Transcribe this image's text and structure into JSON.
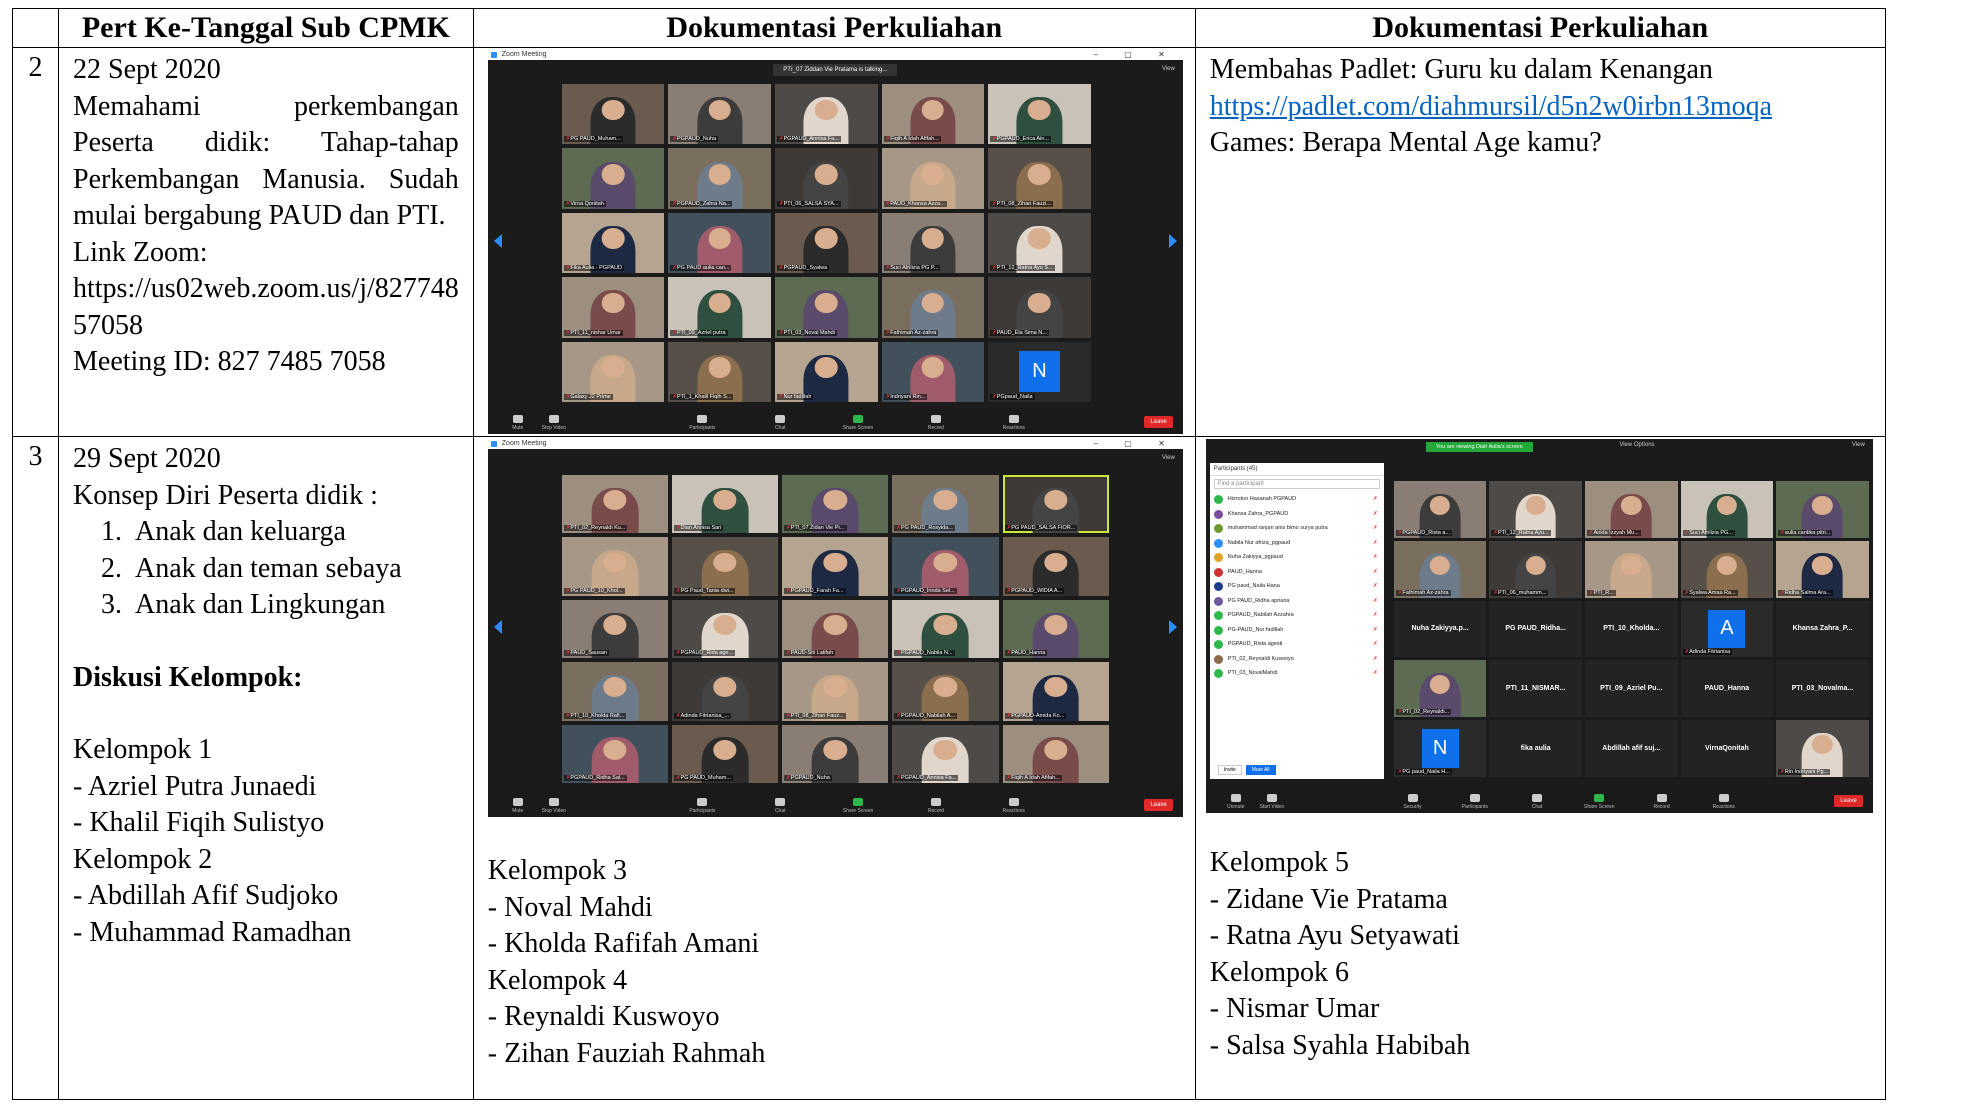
{
  "headers": [
    "Pert Ke-Tanggal Sub CPMK",
    "Dokumentasi Perkuliahan",
    "Dokumentasi Perkuliahan"
  ],
  "row2": {
    "num": "2",
    "date": "22 Sept 2020",
    "desc": "Memahami perkembangan Peserta didik: Tahap-tahap Perkembangan Manusia. Sudah mulai bergabung PAUD dan PTI.",
    "link_label": "Link Zoom:",
    "link_line1": "https://us02web.zoom.us/j/827748",
    "link_line2": "57058",
    "meeting": "Meeting ID: 827 7485 7058",
    "col3_line1": "Membahas Padlet: Guru ku dalam Kenangan",
    "col3_link": "https://padlet.com/diahmursil/d5n2w0irbn13moqa",
    "col3_line3": "Games: Berapa Mental Age kamu?",
    "zoom": {
      "title": "Zoom Meeting",
      "talking": "PTI_07 Ziddan Vie Pratama is talking...",
      "view": "View",
      "tiles": [
        "PG PAUD_Muham...",
        "PGPAUD_Nuha",
        "PGPAUD_Annisa Fa...",
        "Fiqih A Idah Afifah...",
        "PGPAUD_Erica Ain...",
        "Virna Qonitah",
        "PGPAUD_Zahra Na...",
        "PTI_06_SALSA SYA...",
        "PAUD_Khansa Azza...",
        "PTI_08_Zihan Fauzi...",
        "Fika Aulia - PGPAUD",
        "PG PAUD aulia can...",
        "PGPAUD_Syalwa",
        "Suci Afrilizia PG P...",
        "PTI_12_Ratna Ayu S...",
        "PTI_11_nishar Umar",
        "PTI_09_Azriel putra",
        "PTI_03_Noval Mahdi",
        "Fathimah Az-zahra",
        "PAUD_Ela Sima N...",
        "Galaxy J2 Prime",
        "PTI_1_Khalil Fiqih S...",
        "Nur fadillah",
        "Indriyani Rin...",
        "PGpaud_Naila"
      ],
      "letter": "N",
      "toolbar": [
        "Mute",
        "Stop Video",
        "Participants",
        "Chat",
        "Share Screen",
        "Record",
        "Reactions"
      ],
      "leave": "Leave"
    }
  },
  "row3": {
    "num": "3",
    "date": "29 Sept 2020",
    "title": "Konsep Diri Peserta didik :",
    "items": [
      "Anak dan keluarga",
      "Anak dan teman sebaya",
      "Anak dan Lingkungan"
    ],
    "diskusi": "Diskusi Kelompok:",
    "k1": "Kelompok 1",
    "k1a": "- Azriel Putra Junaedi",
    "k1b": "- Khalil Fiqih Sulistyo",
    "k2": "Kelompok 2",
    "k2a": "- Abdillah Afif Sudjoko",
    "k2b": "- Muhammad Ramadhan",
    "k3": "Kelompok 3",
    "k3a": "- Noval Mahdi",
    "k3b": "- Kholda Rafifah Amani",
    "k4": "Kelompok 4",
    "k4a": "- Reynaldi Kuswoyo",
    "k4b": "- Zihan Fauziah Rahmah",
    "k5": "Kelompok 5",
    "k5a": "- Zidane Vie Pratama",
    "k5b": "- Ratna Ayu Setyawati",
    "k6": "Kelompok 6",
    "k6a": "- Nismar Umar",
    "k6b": "- Salsa Syahla Habibah",
    "zoomA": {
      "title": "Zoom Meeting",
      "view": "View",
      "tiles": [
        "PTI_02_Reynaldi Ku...",
        "Dian Annisa Sari",
        "PTI_07 Zidan Vie Pr...",
        "PG PAUD_Rosyida...",
        "PG PAUD_SALSA FIOR...",
        "PG PAUD_10_Khol...",
        "PG Paud_Tania dwi...",
        "PGPAUD_Farah Fa...",
        "PGPAUD_Irinda Sel...",
        "PGPAUD_WIDIA A...",
        "PAUD_Sausan",
        "PGPAUD_Rida age...",
        "PAUD-Siti Latifah",
        "PGPAUD_Nabila N...",
        "PAUD_Hanna",
        "PTI_10_Kholda Rafi...",
        "Adinda Fitrianisa_...",
        "PTI_08_Zihan Fauz...",
        "PGPAUD_Nabilah A...",
        "PGPAUD-Amida Ko...",
        "PGPAUD_Ridha Sal...",
        "PG PAUD_Muham...",
        "PGPAUD_Nuha",
        "PGPAUD_Annisa Fa...",
        "Fiqih A Idah Afifah..."
      ],
      "toolbar": [
        "Mute",
        "Stop Video",
        "Participants",
        "Chat",
        "Share Screen",
        "Record",
        "Reactions"
      ],
      "leave": "Leave"
    },
    "zoomB": {
      "banner": "You are viewing Diah Aulia's screen",
      "view_options": "View Options",
      "view": "View",
      "participants_title": "Participants (45)",
      "find": "Find a participant",
      "participants": [
        "Hizrotun Hasanah PGPAUD",
        "Khansa Zahra_PGPAUD",
        "muhammad ranjan anis bimo surya putra",
        "Nabila Nur afriza_pgpaud",
        "Nuha Zakiyya_pgpaud",
        "PAUD_Hanna",
        "PG paud_Naila Hana",
        "PG PAUD_Ridha apriana",
        "PGPAUD_Nabilah Azzahra",
        "PG-PAUD_Nur fadillah",
        "PGPAUD_Rista agesti",
        "PTI_02_Reynaldi Kuswoyo",
        "PTI_03_NovalMahdi"
      ],
      "invite": "Invite",
      "muteall": "Mute All",
      "tiles": [
        "PGPAUD_Rista a...",
        "PTI_12_Ratna Ayu...",
        "Anida Izzyah Mu...",
        "Suci Afrilizia PG...",
        "aulia cantika pitri...",
        "Fathimah Az-zahra",
        "PTI_06_muhamm...",
        "PTI_R...",
        "Syalwa Amaa Ra...",
        "Ridha Salma Ara..."
      ],
      "text_tiles": [
        "Nuha Zakiyya.p...",
        "PG PAUD_Ridha...",
        "PTI_10_Kholda...",
        "PTI_11_NISMAR...",
        "PTI_09_Azriel Pu...",
        "PAUD_Hanna",
        "PTI_03_Novalma...",
        "fika aulia",
        "Abdillah afif suj...",
        "VirnaQonitah",
        "Khansa Zahra_P..."
      ],
      "letters": [
        "A",
        "N"
      ],
      "toolbar": [
        "Unmute",
        "Start Video",
        "Security",
        "Participants",
        "Chat",
        "Share Screen",
        "Record",
        "Reactions"
      ],
      "leave": "Leave"
    }
  }
}
